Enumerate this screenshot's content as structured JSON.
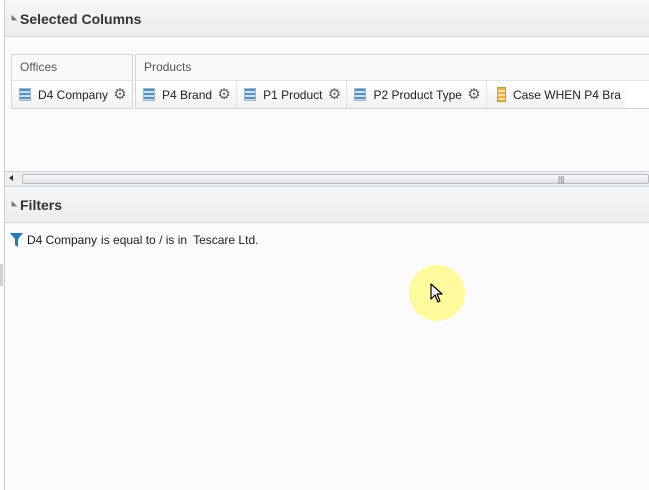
{
  "selected_columns": {
    "title": "Selected Columns",
    "groups": [
      {
        "label": "Offices",
        "chips": [
          {
            "label": "D4 Company",
            "icon": "attribute-column-icon"
          }
        ]
      },
      {
        "label": "Products",
        "chips": [
          {
            "label": "P4 Brand",
            "icon": "attribute-column-icon"
          },
          {
            "label": "P1 Product",
            "icon": "attribute-column-icon"
          },
          {
            "label": "P2 Product Type",
            "icon": "attribute-column-icon"
          },
          {
            "label": "Case WHEN P4 Bra",
            "icon": "calculated-column-icon"
          }
        ]
      }
    ]
  },
  "filters": {
    "title": "Filters",
    "items": [
      {
        "column": "D4 Company",
        "operator": "is equal to / is in",
        "value": "Tescare Ltd.",
        "icon": "filter-funnel-icon"
      }
    ]
  },
  "colors": {
    "accent": "#2a7ab8",
    "highlight": "#fffa8c"
  }
}
